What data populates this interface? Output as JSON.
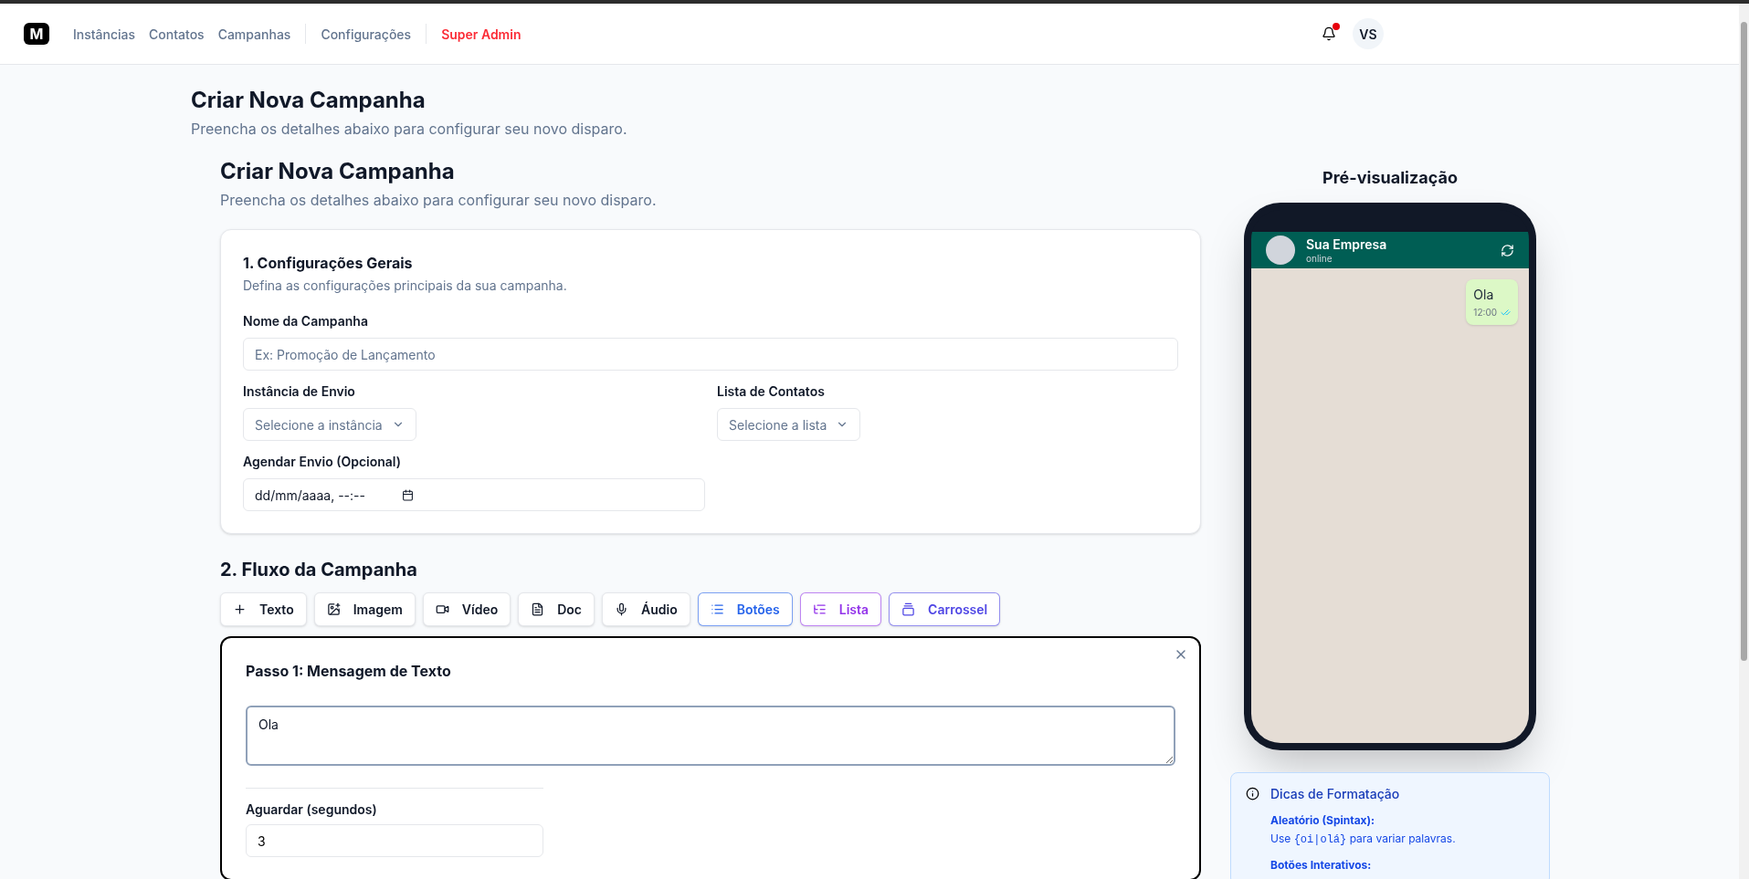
{
  "nav": {
    "logo": "M",
    "links": [
      {
        "label": "Instâncias",
        "kind": "link"
      },
      {
        "label": "Contatos",
        "kind": "link"
      },
      {
        "label": "Campanhas",
        "kind": "link"
      },
      {
        "label": "Configurações",
        "kind": "link"
      },
      {
        "label": "Super Admin",
        "kind": "admin"
      }
    ],
    "notifications": {
      "unread": true
    },
    "avatar": "VS"
  },
  "page": {
    "title": "Criar Nova Campanha",
    "subtitle": "Preencha os detalhes abaixo para configurar seu novo disparo."
  },
  "form": {
    "title": "Criar Nova Campanha",
    "subtitle": "Preencha os detalhes abaixo para configurar seu novo disparo.",
    "general": {
      "title": "1. Configurações Gerais",
      "description": "Defina as configurações principais da sua campanha.",
      "name_label": "Nome da Campanha",
      "name_placeholder": "Ex: Promoção de Lançamento",
      "instance_label": "Instância de Envio",
      "instance_placeholder": "Selecione a instância",
      "list_label": "Lista de Contatos",
      "list_placeholder": "Selecione a lista",
      "schedule_label": "Agendar Envio (Opcional)",
      "schedule_value": "dd/mm/aaaa, --:--"
    },
    "flow": {
      "title": "2. Fluxo da Campanha",
      "buttons": [
        {
          "label": "Texto",
          "kind": "basic"
        },
        {
          "label": "Imagem",
          "kind": "basic"
        },
        {
          "label": "Vídeo",
          "kind": "basic"
        },
        {
          "label": "Doc",
          "kind": "basic"
        },
        {
          "label": "Áudio",
          "kind": "basic"
        },
        {
          "label": "Botões",
          "kind": "accent",
          "color": "#2563eb"
        },
        {
          "label": "Lista",
          "kind": "accent",
          "color": "#9333ea"
        },
        {
          "label": "Carrossel",
          "kind": "accent",
          "color": "#4f46e5"
        }
      ],
      "steps": [
        {
          "title": "Passo 1: Mensagem de Texto",
          "message": "Ola",
          "wait_label": "Aguardar (segundos)",
          "wait_value": "3"
        }
      ]
    }
  },
  "preview": {
    "title": "Pré-visualização",
    "contact": "Sua Empresa",
    "status": "online",
    "messages": [
      {
        "text": "Ola",
        "time": "12:00",
        "read": true
      }
    ]
  },
  "tips": {
    "title": "Dicas de Formatação",
    "items": [
      {
        "label": "Aleatório (Spintax):",
        "before": "Use",
        "code": "{oi|olá}",
        "after": "para variar palavras."
      },
      {
        "label": "Botões Interativos:"
      }
    ]
  }
}
